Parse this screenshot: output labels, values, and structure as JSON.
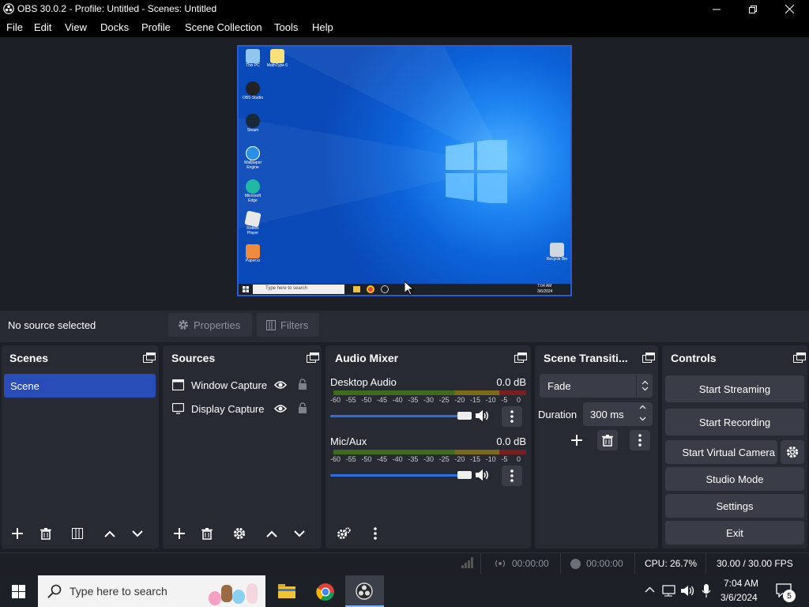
{
  "window": {
    "title": "OBS 30.0.2 - Profile: Untitled - Scenes: Untitled"
  },
  "menu": [
    "File",
    "Edit",
    "View",
    "Docks",
    "Profile",
    "Scene Collection",
    "Tools",
    "Help"
  ],
  "preview": {
    "desktop_icons": [
      "This PC",
      "MathType 6",
      "OBS Studio",
      "Steam",
      "Wallpaper Engine",
      "Microsoft Edge",
      "Roblox Player",
      "Paper.io"
    ],
    "recycle_bin": "Recycle Bin",
    "search_placeholder": "Type here to search",
    "time": "7:04 AM",
    "date": "3/6/2024"
  },
  "context_bar": {
    "no_source": "No source selected",
    "properties": "Properties",
    "filters": "Filters"
  },
  "scenes": {
    "title": "Scenes",
    "items": [
      "Scene"
    ]
  },
  "sources": {
    "title": "Sources",
    "items": [
      "Window Capture",
      "Display Capture"
    ]
  },
  "audio_mixer": {
    "title": "Audio Mixer",
    "channels": [
      {
        "name": "Desktop Audio",
        "db": "0.0 dB",
        "volume": 1.0
      },
      {
        "name": "Mic/Aux",
        "db": "0.0 dB",
        "volume": 1.0
      }
    ],
    "scale": [
      "-60",
      "-55",
      "-50",
      "-45",
      "-40",
      "-35",
      "-30",
      "-25",
      "-20",
      "-15",
      "-10",
      "-5",
      "0"
    ]
  },
  "transitions": {
    "title": "Scene Transiti...",
    "selected": "Fade",
    "duration_label": "Duration",
    "duration_value": "300 ms"
  },
  "controls": {
    "title": "Controls",
    "start_streaming": "Start Streaming",
    "start_recording": "Start Recording",
    "virtual_camera": "Start Virtual Camera",
    "studio_mode": "Studio Mode",
    "settings": "Settings",
    "exit": "Exit"
  },
  "status": {
    "stream_time": "00:00:00",
    "rec_time": "00:00:00",
    "cpu": "CPU: 26.7%",
    "fps": "30.00 / 30.00 FPS"
  },
  "taskbar": {
    "search_placeholder": "Type here to search",
    "time": "7:04 AM",
    "date": "3/6/2024",
    "notifications": "5"
  },
  "colors": {
    "accent": "#2a5ccf",
    "panel": "#272a33",
    "background": "#1d1f26",
    "button": "#3a3d47"
  }
}
